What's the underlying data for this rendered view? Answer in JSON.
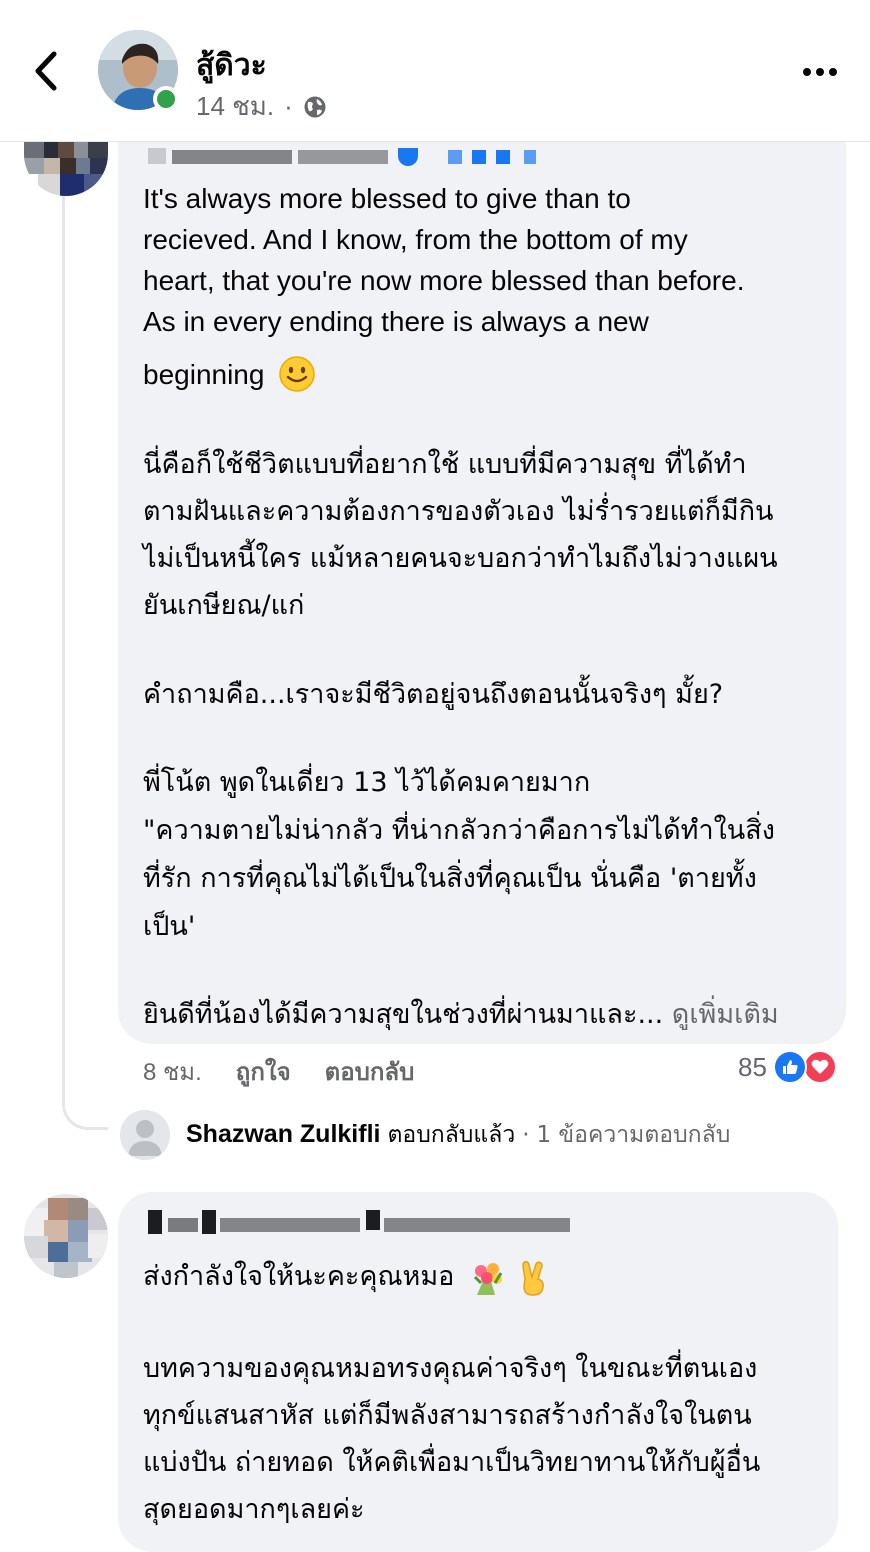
{
  "header": {
    "author_name": "สู้ดิวะ",
    "post_time": "14 ชม.",
    "separator": "·",
    "privacy_icon": "globe-icon",
    "back_icon": "chevron-left-icon",
    "more_icon": "more-horizontal-icon"
  },
  "comment1": {
    "author_name_redacted": true,
    "lines": [
      "It's always more blessed to give than to",
      "recieved. And I know, from the bottom of my",
      "heart, that you're now more blessed than before.",
      "As in every ending there is always a new",
      "beginning"
    ],
    "thai_paragraph_1": [
      "นี่คือก็ใช้ชีวิตแบบที่อยากใช้ แบบที่มีความสุข ที่ได้ทำ",
      "ตามฝันและความต้องการของตัวเอง ไม่ร่ำรวยแต่ก็มีกิน",
      "ไม่เป็นหนี้ใคร แม้หลายคนจะบอกว่าทำไมถึงไม่วางแผน",
      "ยันเกษียณ/แก่"
    ],
    "thai_paragraph_2": "คำถามคือ...เราจะมีชีวิตอยู่จนถึงตอนนั้นจริงๆ มั้ย?",
    "thai_paragraph_3": [
      "พี่โน้ต พูดในเดี่ยว 13 ไว้ได้คมคายมาก",
      "\"ความตายไม่น่ากลัว ที่น่ากลัวกว่าคือการไม่ได้ทำในสิ่ง",
      "ที่รัก การที่คุณไม่ได้เป็นในสิ่งที่คุณเป็น นั่นคือ 'ตายทั้ง",
      "เป็น'"
    ],
    "truncated_line": "ยินดีที่น้องได้มีความสุขในช่วงที่ผ่านมาและ...",
    "see_more": "ดูเพิ่มเติม",
    "time": "8 ชม.",
    "like_label": "ถูกใจ",
    "reply_label": "ตอบกลับ",
    "reaction_count": "85",
    "reaction_icons": [
      "like-icon",
      "love-icon"
    ],
    "reply_summary": {
      "name": "Shazwan Zulkifli",
      "replied": "ตอบกลับแล้ว",
      "separator": "·",
      "count_text": "1 ข้อความตอบกลับ"
    }
  },
  "comment2": {
    "author_name_redacted": true,
    "first_line": "ส่งกำลังใจให้นะคะคุณหมอ",
    "emojis": [
      "bouquet-emoji",
      "victory-hand-emoji"
    ],
    "paragraph": [
      "บทความของคุณหมอทรงคุณค่าจริงๆ ในขณะที่ตนเอง",
      "ทุกข์แสนสาหัส แต่ก็มีพลังสามารถสร้างกำลังใจในตน",
      "แบ่งปัน ถ่ายทอด ให้คติเพื่อมาเป็นวิทยาทานให้กับผู้อื่น",
      "สุดยอดมากๆเลยค่ะ"
    ]
  },
  "colors": {
    "bubble": "#f0f2f5",
    "secondary_text": "#65676b",
    "online": "#31a24c",
    "like": "#1877f2",
    "love": "#f33e58"
  }
}
